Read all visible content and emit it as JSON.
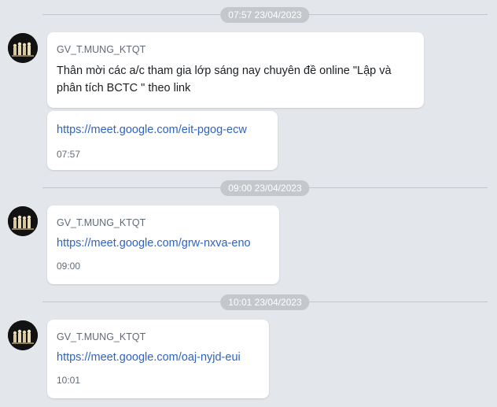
{
  "messages": [
    {
      "date_pill": "07:57 23/04/2023",
      "sender": "GV_T.MUNG_KTQT",
      "text": "Thân mời các a/c tham gia lớp sáng nay chuyên đề online \"Lập và phân tích BCTC \" theo link",
      "link": "https://meet.google.com/eit-pgog-ecw",
      "time": "07:57"
    },
    {
      "date_pill": "09:00 23/04/2023",
      "sender": "GV_T.MUNG_KTQT",
      "link": "https://meet.google.com/grw-nxva-eno",
      "time": "09:00"
    },
    {
      "date_pill": "10:01 23/04/2023",
      "sender": "GV_T.MUNG_KTQT",
      "link": "https://meet.google.com/oaj-nyjd-eui",
      "time": "10:01"
    }
  ],
  "colors": {
    "background": "#e3e6ea",
    "bubble": "#ffffff",
    "link": "#2f63c4",
    "pill": "#c4c7cb"
  },
  "icons": {
    "avatar": "sender-avatar-photo"
  }
}
